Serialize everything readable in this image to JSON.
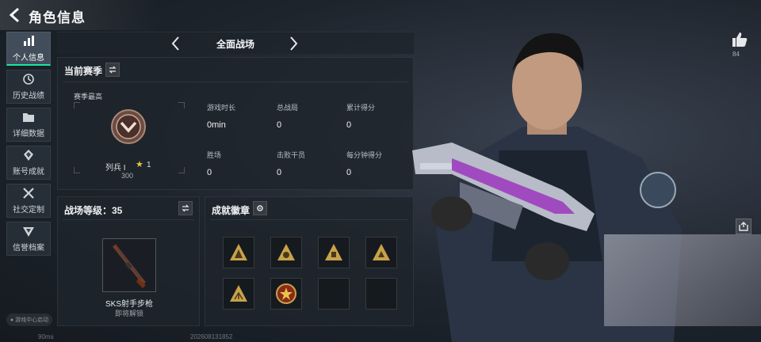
{
  "header": {
    "title": "角色信息"
  },
  "sidebar": {
    "items": [
      {
        "label": "个人信息",
        "icon": "bar-chart-icon",
        "active": true
      },
      {
        "label": "历史战绩",
        "icon": "history-icon",
        "active": false
      },
      {
        "label": "详细数据",
        "icon": "folder-icon",
        "active": false
      },
      {
        "label": "账号成就",
        "icon": "medal-icon",
        "active": false
      },
      {
        "label": "社交定制",
        "icon": "tools-icon",
        "active": false
      },
      {
        "label": "信誉档案",
        "icon": "shield-icon",
        "active": false
      }
    ],
    "footer": "游戏中心启动"
  },
  "mode": {
    "title": "全面战场"
  },
  "season": {
    "title": "当前赛季",
    "subtitle": "赛季最高",
    "rank_name": "列兵 I",
    "rank_stars": "1",
    "rank_points": "300",
    "stats": [
      {
        "label": "游戏时长",
        "value": "0min"
      },
      {
        "label": "总战局",
        "value": "0"
      },
      {
        "label": "累计得分",
        "value": "0"
      },
      {
        "label": "胜场",
        "value": "0"
      },
      {
        "label": "击败干员",
        "value": "0"
      },
      {
        "label": "每分钟得分",
        "value": "0"
      }
    ]
  },
  "battle_level": {
    "title": "战场等级：35",
    "weapon_name": "SKS射手步枪",
    "weapon_status": "即将解锁"
  },
  "achievements": {
    "title": "成就徽章",
    "badges": [
      "badge-icon",
      "badge-icon",
      "badge-icon",
      "badge-icon",
      "badge-icon",
      "star-badge-icon",
      "empty",
      "empty"
    ]
  },
  "profile": {
    "likes": "84"
  },
  "status": {
    "latency": "90ms",
    "uid": "202608131852"
  },
  "colors": {
    "accent": "#19e6a0",
    "badge": "#c8a24a",
    "star": "#e8c547"
  }
}
